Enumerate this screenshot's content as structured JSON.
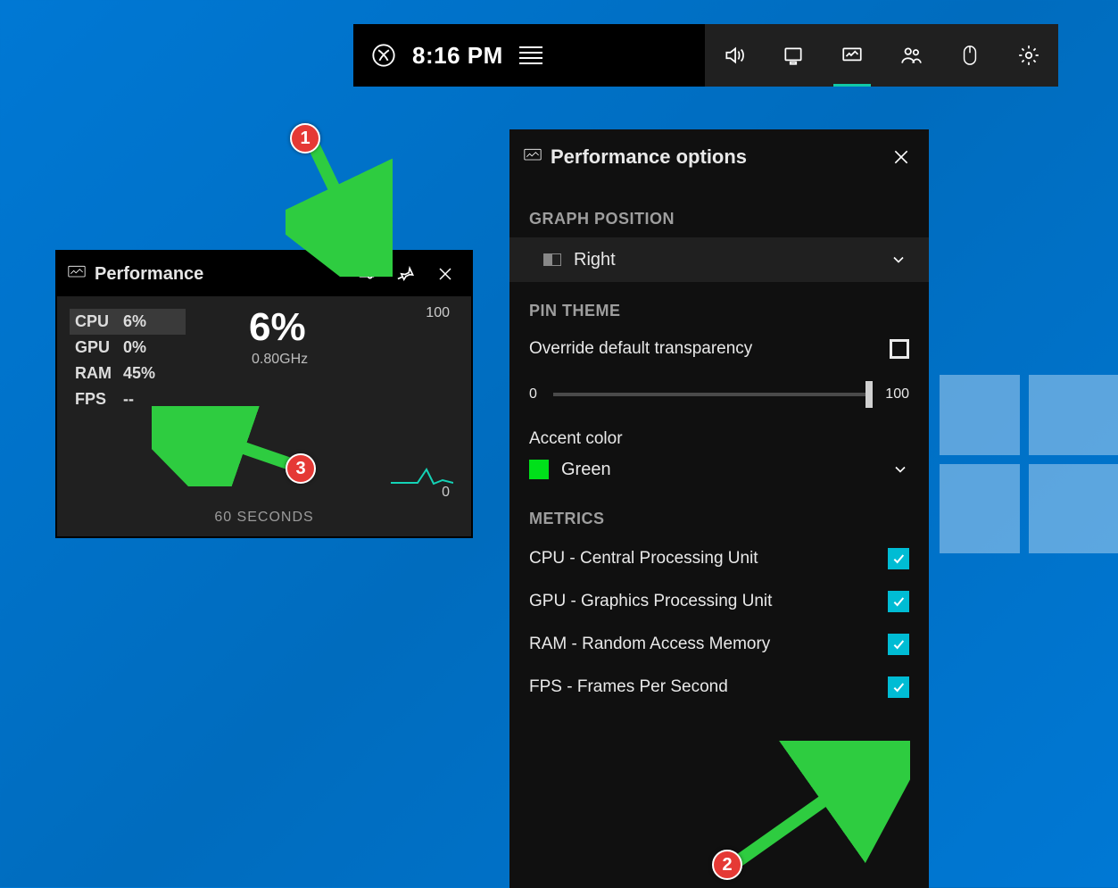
{
  "topbar": {
    "time": "8:16 PM",
    "icons": [
      "xbox",
      "menu-lines",
      "audio",
      "capture",
      "performance",
      "social",
      "mouse",
      "settings"
    ],
    "active": "performance"
  },
  "perf": {
    "title": "Performance",
    "stats": [
      {
        "label": "CPU",
        "value": "6%",
        "selected": true
      },
      {
        "label": "GPU",
        "value": "0%",
        "selected": false
      },
      {
        "label": "RAM",
        "value": "45%",
        "selected": false
      },
      {
        "label": "FPS",
        "value": "--",
        "selected": false
      }
    ],
    "big_value": "6%",
    "sub_value": "0.80GHz",
    "y_max": "100",
    "y_min": "0",
    "x_label": "60 SECONDS"
  },
  "opts": {
    "title": "Performance options",
    "sections": {
      "graph_position": {
        "heading": "GRAPH POSITION",
        "value": "Right"
      },
      "pin_theme": {
        "heading": "PIN THEME",
        "override_label": "Override default transparency",
        "override_checked": false,
        "slider_min": "0",
        "slider_max": "100",
        "slider_value": 100
      },
      "accent": {
        "label": "Accent color",
        "value": "Green",
        "swatch": "#00e01a"
      },
      "metrics": {
        "heading": "METRICS",
        "items": [
          {
            "label": "CPU - Central Processing Unit",
            "checked": true
          },
          {
            "label": "GPU - Graphics Processing Unit",
            "checked": true
          },
          {
            "label": "RAM - Random Access Memory",
            "checked": true
          },
          {
            "label": "FPS - Frames Per Second",
            "checked": true
          }
        ]
      }
    }
  },
  "annotations": {
    "badge1": "1",
    "badge2": "2",
    "badge3": "3"
  }
}
